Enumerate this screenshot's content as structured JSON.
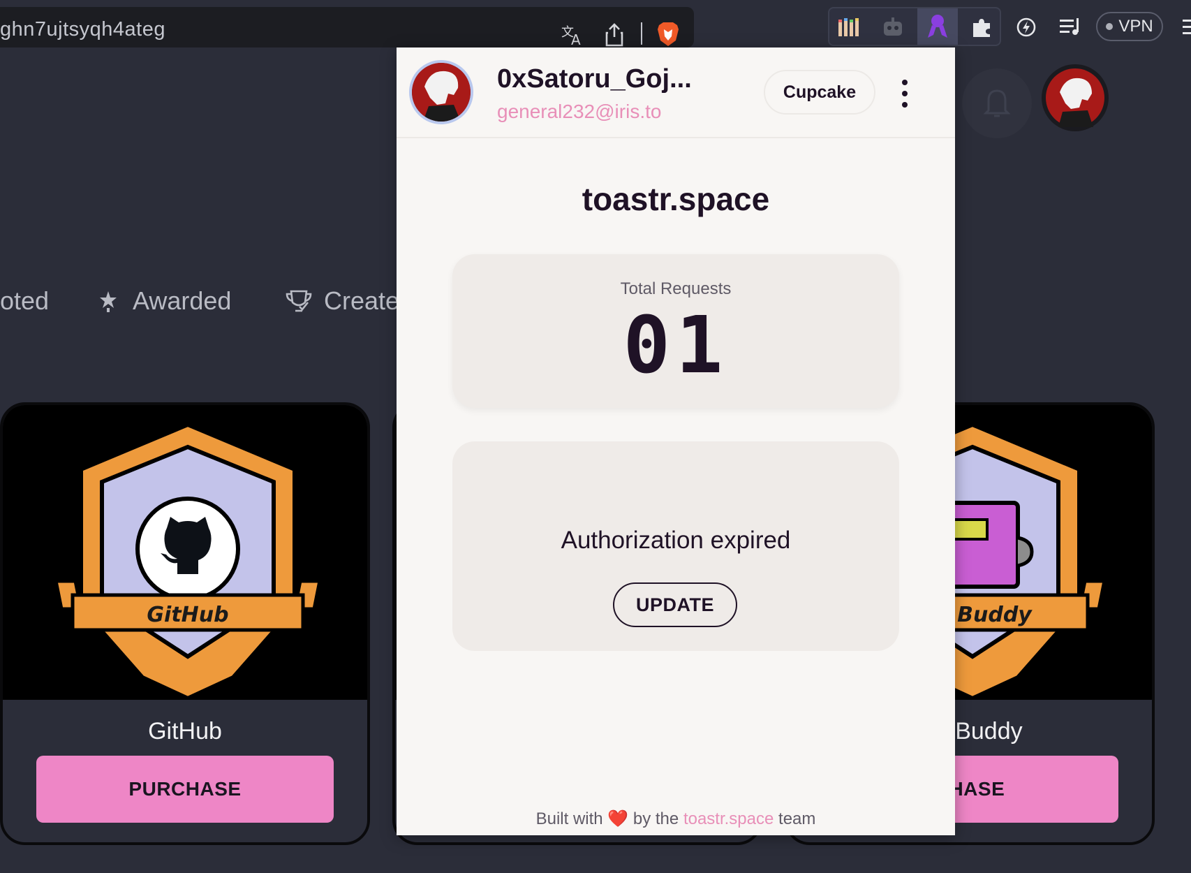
{
  "browser": {
    "url_fragment": "ghn7ujtsyqh4ateg",
    "vpn_label": "VPN"
  },
  "page": {
    "tabs": [
      {
        "label": "oted"
      },
      {
        "label": "Awarded"
      },
      {
        "label": "Create"
      }
    ],
    "cards": [
      {
        "badge_text": "GitHub",
        "title": "GitHub",
        "button": "PURCHASE"
      },
      {
        "badge_text": "est Buddy",
        "title": "est Buddy",
        "button": "CHASE"
      }
    ]
  },
  "popup": {
    "user_name": "0xSatoru_Goj...",
    "user_email": "general232@iris.to",
    "account_button": "Cupcake",
    "site": "toastr.space",
    "stats_label": "Total Requests",
    "stats_value": "01",
    "auth_message": "Authorization expired",
    "update_button": "UPDATE",
    "footer": {
      "prefix": "Built with",
      "heart": "❤️",
      "middle": "by the",
      "link": "toastr.space",
      "suffix": "team"
    }
  },
  "colors": {
    "accent_pink": "#ee86c6",
    "popup_bg": "#f8f6f4",
    "page_bg": "#2b2d39",
    "badge_orange": "#ee9a3c",
    "badge_lavender": "#c3c3ea"
  }
}
